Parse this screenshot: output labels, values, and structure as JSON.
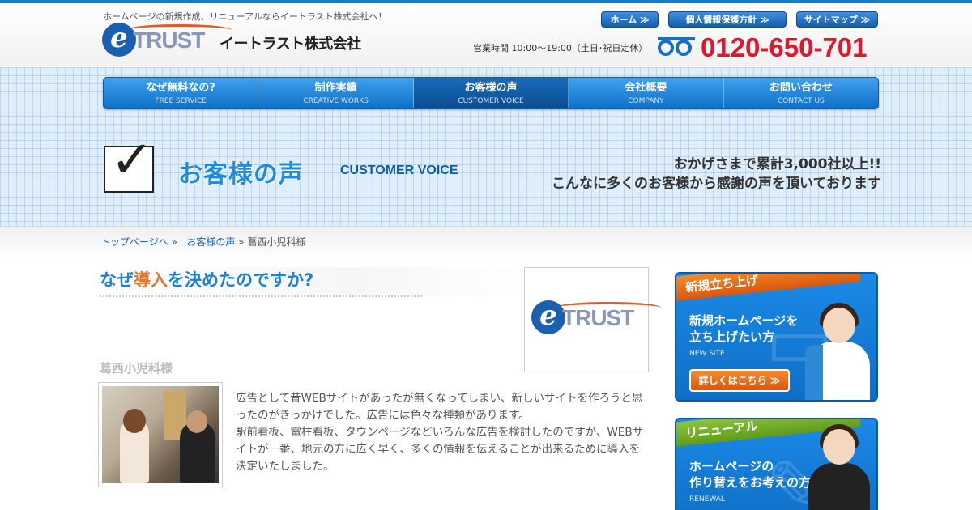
{
  "header": {
    "tagline": "ホームページの新規作成、リニューアルならイートラスト株式会社へ！",
    "logo_e": "e",
    "logo_trust": "TRUST",
    "company_name": "イートラスト株式会社",
    "hours": "営業時間 10:00～19:00（土日･祝日定休）",
    "phone": "0120-650-701",
    "top_buttons": [
      "ホーム ≫",
      "個人情報保護方針 ≫",
      "サイトマップ ≫"
    ]
  },
  "nav": [
    {
      "jp": "なぜ無料なの?",
      "en": "FREE SERVICE"
    },
    {
      "jp": "制作実績",
      "en": "CREATIVE WORKS"
    },
    {
      "jp": "お客様の声",
      "en": "CUSTOMER VOICE"
    },
    {
      "jp": "会社概要",
      "en": "COMPANY"
    },
    {
      "jp": "お問い合わせ",
      "en": "CONTACT US"
    }
  ],
  "hero": {
    "title": "お客様の声",
    "title_en": "CUSTOMER VOICE",
    "line1": "おかげさまで累計3,000社以上!!",
    "line2": "こんなに多くのお客様から感謝の声を頂いております"
  },
  "breadcrumb": {
    "home": "トップページへ",
    "sep": "»",
    "section": "お客様の声",
    "current": "葛西小児科様"
  },
  "main": {
    "why_pre": "なぜ",
    "why_accent": "導入",
    "why_post": "を決めたのですか?",
    "client": "葛西小児科様",
    "body_p1": "広告として昔WEBサイトがあったが無くなってしまい、新しいサイトを作ろうと思ったのがきっかけでした。広告には色々な種類があります。",
    "body_p2": "駅前看板、電柱看板、タウンページなどいろんな広告を検討したのですが、WEBサイトが一番、地元の方に広く早く、多くの情報を伝えることが出来るために導入を決定いたしました。"
  },
  "sidebar": {
    "new": {
      "ribbon": "新規立ち上げ",
      "title_1": "新規ホームページを",
      "title_2": "立ち上げたい方",
      "sub": "NEW SITE",
      "button": "詳しくはこちら ≫"
    },
    "renew": {
      "ribbon": "リニューアル",
      "title_1": "ホームページの",
      "title_2": "作り替えをお考えの方",
      "sub": "RENEWAL"
    }
  },
  "colors": {
    "brand_blue": "#0f6fc7",
    "phone_red": "#e0182d",
    "accent_orange": "#e5732a"
  }
}
